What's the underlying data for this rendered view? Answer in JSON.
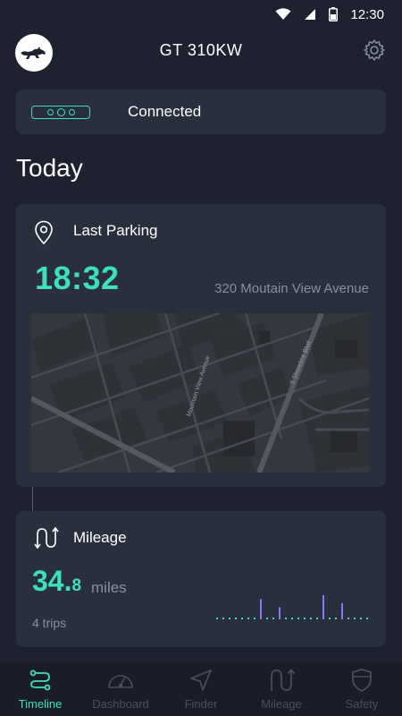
{
  "status_bar": {
    "time": "12:30"
  },
  "header": {
    "title": "GT 310KW"
  },
  "connection": {
    "status": "Connected"
  },
  "section_title": "Today",
  "parking": {
    "title": "Last Parking",
    "time": "18:32",
    "address": "320 Moutain View Avenue",
    "map_labels": {
      "street_1": "Mountain View Avenue",
      "street_2": "S Shoreline Blvd"
    }
  },
  "mileage": {
    "title": "Mileage",
    "value_int": "34.",
    "value_dec": "8",
    "unit": "miles",
    "trips": "4 trips"
  },
  "nav": {
    "items": [
      {
        "label": "Timeline",
        "icon": "timeline-icon",
        "active": true
      },
      {
        "label": "Dashboard",
        "icon": "dashboard-icon",
        "active": false
      },
      {
        "label": "Finder",
        "icon": "finder-icon",
        "active": false
      },
      {
        "label": "Mileage",
        "icon": "mileage-icon",
        "active": false
      },
      {
        "label": "Safety",
        "icon": "safety-icon",
        "active": false
      }
    ]
  },
  "colors": {
    "accent": "#3de0b8",
    "background": "#1e2230",
    "card": "#2a2f3e",
    "muted": "#8a8f9d",
    "chart_purple": "#8a78f0"
  }
}
